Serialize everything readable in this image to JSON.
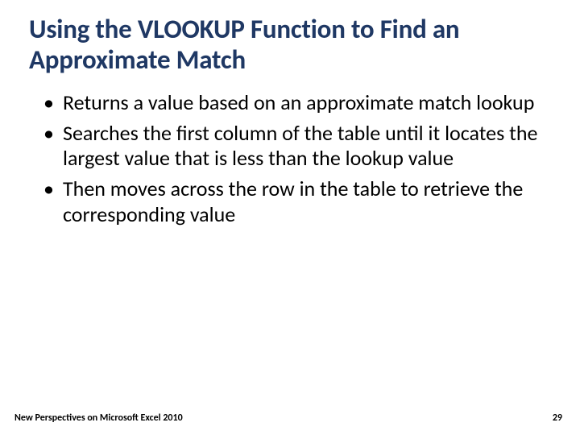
{
  "slide": {
    "title": "Using the VLOOKUP Function to Find an Approximate Match",
    "bullets": [
      "Returns a value based on an approximate match lookup",
      "Searches the first column of the table until it locates the largest value that is less than the lookup value",
      "Then moves across the row in the table to retrieve the corresponding value"
    ],
    "footer_text": "New Perspectives on Microsoft Excel 2010",
    "page_number": "29"
  }
}
